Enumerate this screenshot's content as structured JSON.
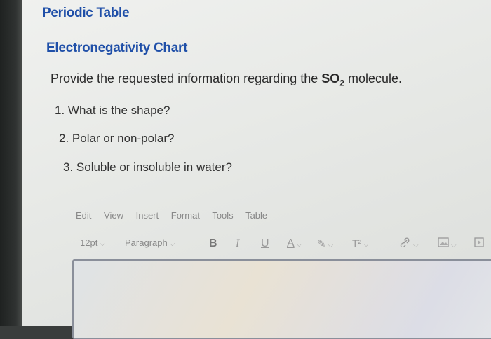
{
  "links": {
    "periodic_table": "Periodic Table",
    "electronegativity_chart": "Electronegativity Chart"
  },
  "prompt": {
    "before": "Provide the requested information regarding the ",
    "molecule_main": "SO",
    "molecule_sub": "2",
    "after": " molecule."
  },
  "questions": [
    "1. What is the shape?",
    "2. Polar or non-polar?",
    "3. Soluble or insoluble in water?"
  ],
  "editor_menu": [
    "Edit",
    "View",
    "Insert",
    "Format",
    "Tools",
    "Table"
  ],
  "editor_toolbar": {
    "font_size": "12pt",
    "block_format": "Paragraph",
    "bold": "B",
    "italic": "I",
    "underline": "U",
    "text_color": "A",
    "highlight": "✎",
    "superscript": "T²"
  },
  "colors": {
    "link": "#1f4fa8",
    "editor_border": "#8a8f9a"
  }
}
